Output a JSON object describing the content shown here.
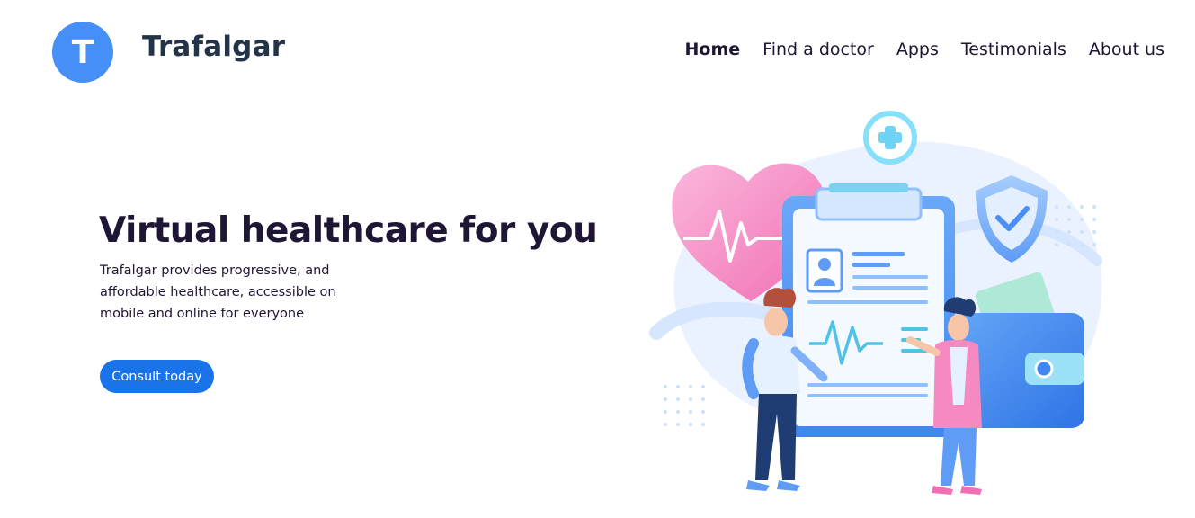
{
  "brand": {
    "logo_letter": "T",
    "name": "Trafalgar"
  },
  "nav": {
    "items": [
      {
        "label": "Home",
        "active": true
      },
      {
        "label": "Find a doctor",
        "active": false
      },
      {
        "label": "Apps",
        "active": false
      },
      {
        "label": "Testimonials",
        "active": false
      },
      {
        "label": "About us",
        "active": false
      }
    ]
  },
  "hero": {
    "title": "Virtual healthcare for you",
    "description": "Trafalgar provides progressive, and affordable healthcare, accessible on mobile and online for everyone",
    "cta_label": "Consult today"
  },
  "colors": {
    "brand_blue": "#458ff6",
    "button_blue": "#1a73e8",
    "heading_dark": "#1f1534"
  },
  "illustration": {
    "icons": [
      "heart-icon",
      "medical-cross-icon",
      "shield-check-icon",
      "clipboard-icon",
      "wallet-icon",
      "doctor-figure",
      "patient-figure"
    ]
  }
}
